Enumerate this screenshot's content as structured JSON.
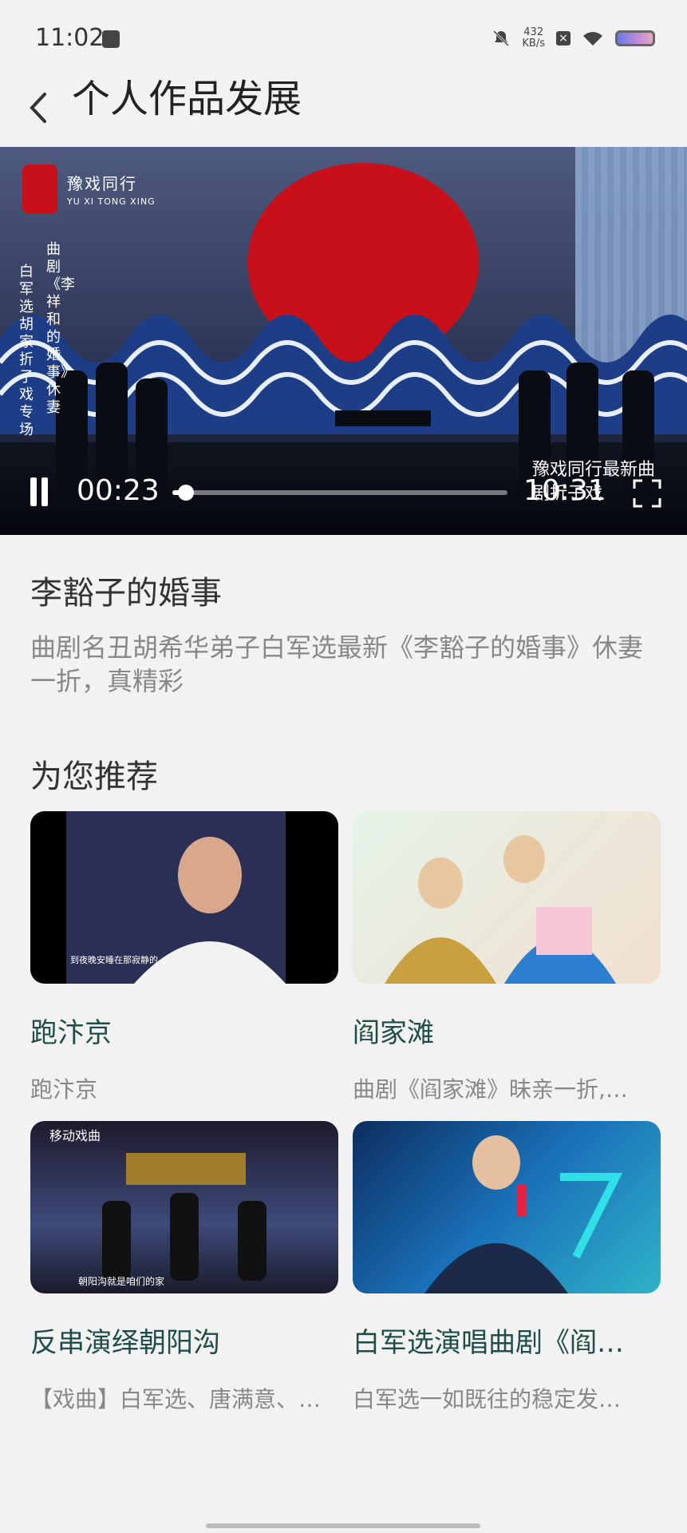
{
  "status_bar": {
    "time": "11:02",
    "network_speed_value": "432",
    "network_speed_unit": "KB/s"
  },
  "header": {
    "title": "个人作品发展"
  },
  "player": {
    "logo_text": "豫戏同行",
    "logo_subtext": "YU XI TONG XING",
    "side_caption_1": "曲剧《李祥和的婚事》休妻",
    "side_caption_2": "白军选胡家折子戏专场",
    "overlay_text": "豫戏同行最新曲剧折子戏",
    "current_time": "00:23",
    "total_time": "10:31",
    "progress": 0.04
  },
  "video": {
    "title": "李豁子的婚事",
    "description": "曲剧名丑胡希华弟子白军选最新《李豁子的婚事》休妻一折，真精彩"
  },
  "recommend": {
    "section_title": "为您推荐",
    "items": [
      {
        "title": "跑汴京",
        "subtitle": "跑汴京"
      },
      {
        "title": "阎家滩",
        "subtitle": "曲剧《阎家滩》昧亲一折,…"
      },
      {
        "title": "反串演绎朝阳沟",
        "subtitle": "【戏曲】白军选、唐满意、…"
      },
      {
        "title": "白军选演唱曲剧《阎…",
        "subtitle": "白军选一如既往的稳定发…"
      }
    ],
    "thumb_1_caption": "到夜晚安睡在那寂静的…",
    "thumb_3_brand": "移动戏曲",
    "thumb_3_caption": "朝阳沟就是咱们的家"
  }
}
